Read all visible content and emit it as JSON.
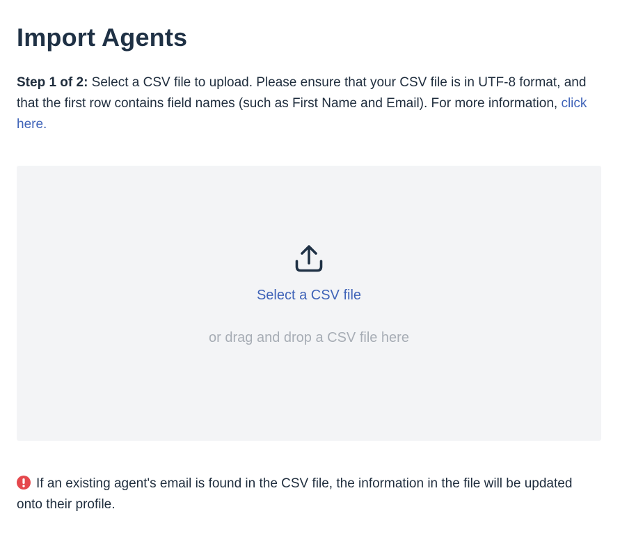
{
  "page": {
    "title": "Import Agents"
  },
  "intro": {
    "step_label": "Step 1 of 2:",
    "text": " Select a CSV file to upload. Please ensure that your CSV file is in UTF-8 format, and that the first row contains field names (such as First Name and Email). For more information, ",
    "link_text": "click here."
  },
  "dropzone": {
    "icon": "upload-icon",
    "select_label": "Select a CSV file",
    "drag_hint": "or drag and drop a CSV file here"
  },
  "notice": {
    "icon": "alert-circle-icon",
    "icon_color": "#e5484d",
    "text": "If an existing agent's email is found in the CSV file, the information in the file will be updated onto their profile."
  },
  "colors": {
    "link": "#3f63b8",
    "title": "#1f3145",
    "dropzone_bg": "#f3f4f6",
    "muted_text": "#a7adb5"
  }
}
